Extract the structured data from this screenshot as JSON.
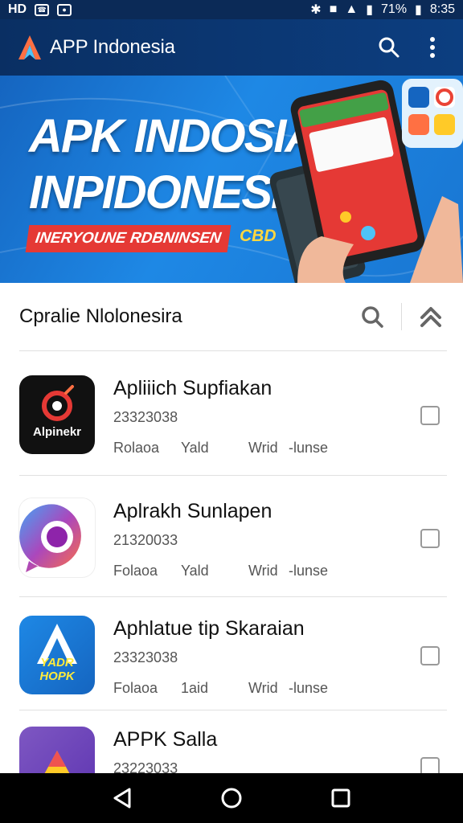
{
  "status_bar": {
    "left_icons": [
      "HD",
      "phone-icon",
      "app-icon"
    ],
    "left_label": "HD",
    "battery_percent": "71%",
    "time": "8:35"
  },
  "app_bar": {
    "title": "APP Indonesia",
    "search_icon": "search-icon",
    "menu_icon": "more-vert-icon"
  },
  "banner": {
    "line1": "APK INDOSIA",
    "line2": "INPIDONESIA",
    "ribbon": "INERYOUNE RDBNINSEN",
    "tag": "CBD"
  },
  "section": {
    "title": "Cpralie Nlolonesira"
  },
  "apps": [
    {
      "title": "Apliiich Supfiakan",
      "subtitle": "23323038",
      "meta": [
        "Rolaoa",
        "Yald",
        "Wrid",
        "-lunse"
      ],
      "icon_label": "Alpinekr"
    },
    {
      "title": "Aplrakh Sunlapen",
      "subtitle": "21320033",
      "meta": [
        "Folaoa",
        "Yald",
        "Wrid",
        "-lunse"
      ],
      "icon_label": ""
    },
    {
      "title": "Aphlatue tip Skaraian",
      "subtitle": "23323038",
      "meta": [
        "Folaoa",
        "1aid",
        "Wrid",
        "-lunse"
      ],
      "icon_label": "YADR HOPK"
    },
    {
      "title": "APPK Salla",
      "subtitle": "23223033",
      "meta": [],
      "icon_label": ""
    }
  ],
  "colors": {
    "app_bar": "#0b3571",
    "banner": "#1976d2",
    "ribbon": "#e53935",
    "nav_bar": "#000000"
  }
}
